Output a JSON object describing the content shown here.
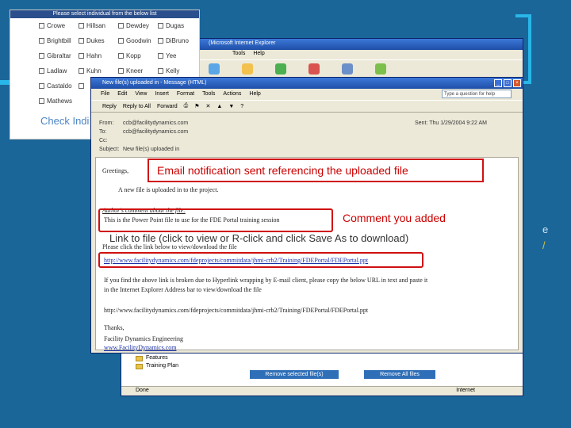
{
  "panel": {
    "header": "Please select individual from the below list",
    "names": [
      "Crowe",
      "Hillsan",
      "Dewdey",
      "Dugas",
      "Brightbill",
      "Dukes",
      "Goodwin",
      "DiBruno",
      "Gibraltar",
      "Hahn",
      "Kopp",
      "Yee",
      "Ladlaw",
      "Kuhn",
      "Kneer",
      "Kelly",
      "Castaldo",
      "",
      "",
      "",
      "Mathews",
      "",
      "",
      ""
    ],
    "check_label": "Check Indi"
  },
  "ie": {
    "title": "(Microsoft Internet Explorer",
    "menu": [
      "Tools",
      "Help"
    ],
    "tree": [
      "Features",
      "Training Plan"
    ],
    "remove_selected": "Remove selected file(s)",
    "remove_all": "Remove All files",
    "status_left": "Done",
    "status_right": "Internet"
  },
  "message": {
    "title": "New file(s) uploaded in - Message (HTML)",
    "menu": [
      "File",
      "Edit",
      "View",
      "Insert",
      "Format",
      "Tools",
      "Actions",
      "Help"
    ],
    "ask_placeholder": "Type a question for help",
    "toolbar": [
      "Reply",
      "Reply to All",
      "Forward"
    ],
    "from_label": "From:",
    "from_value": "ccb@facilitydynamics.com",
    "to_label": "To:",
    "to_value": "ccb@facilitydynamics.com",
    "cc_label": "Cc:",
    "cc_value": "",
    "subject_label": "Subject:",
    "subject_value": "New file(s) uploaded in",
    "sent_label": "Sent:",
    "sent_value": "Thu 1/29/2004 9:22 AM",
    "greeting": "Greetings,",
    "intro": "A new file is uploaded in to the project.",
    "comment_heading": "Author's comment about the file:",
    "comment": "This is the Power Point file to use for the FDE Portal training session",
    "link_instruction": "Please click the link below to view/download the file",
    "link_url": "http://www.facilitydynamics.com/fdeprojects/commitdata/jhmi-crb2/Training/FDEPortal/FDEPortal.ppt",
    "broken_note_1": "If you find the above link is broken due to Hyperlink wrapping by E-mail client, please copy the below URL in text and paste it",
    "broken_note_2": "in the Internet Explorer Address bar to view/download the file",
    "plain_url": "http://www.facilitydynamics.com/fdeprojects/commitdata/jhmi-crb2/Training/FDEPortal/FDEPortal.ppt",
    "thanks": "Thanks,",
    "signature": "Facility Dynamics Engineering",
    "signature_link": "www.FacilityDynamics.com"
  },
  "annotations": {
    "email_note": "Email notification sent referencing the uploaded file",
    "comment_note": "Comment you added",
    "link_note": "Link to file (click to view or R-click and click Save As to download)",
    "edge_glyph_1": "e",
    "edge_glyph_2": "/"
  },
  "colors": {
    "slide_bg": "#1a6699",
    "accent": "#29b6e8",
    "annotation_red": "#cc0000",
    "check_label_blue": "#4d86c4"
  }
}
